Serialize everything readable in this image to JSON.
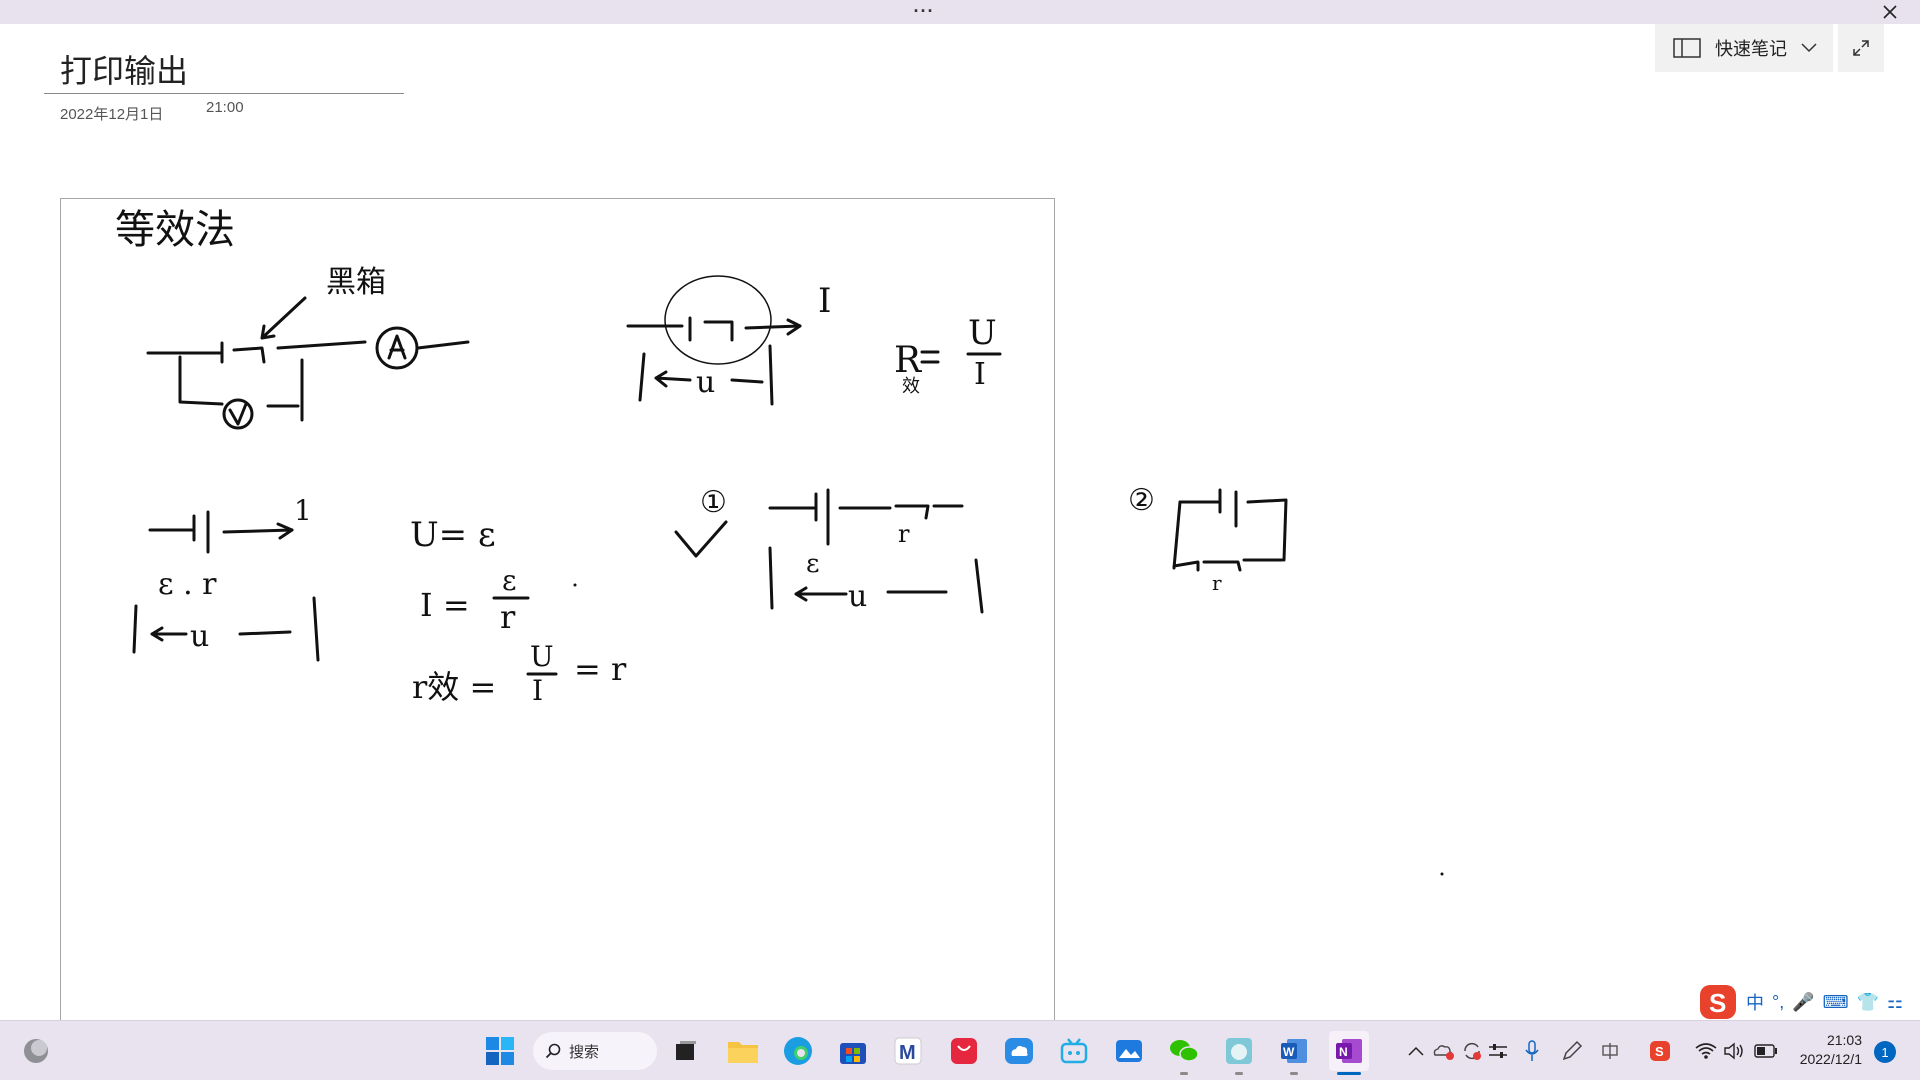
{
  "window": {
    "more_label": "···",
    "close_label": "✕"
  },
  "toolbar": {
    "quick_note_label": "快速笔记"
  },
  "page": {
    "title": "打印输出",
    "date": "2022年12月1日",
    "time": "21:00"
  },
  "ink": {
    "heading": "等效法",
    "black_box": "黑箱",
    "current_I": "I",
    "R_formula_lhs": "R",
    "R_formula_sub": "效",
    "R_formula_num": "U",
    "R_formula_den": "I",
    "label_e_r": "ε . r",
    "label_u_bottom": "u",
    "eq1": "U= ε",
    "eq2_lhs": "I =",
    "eq2_num": "ε",
    "eq2_den": "r",
    "eq3_lhs": "r效 =",
    "eq3_num": "U",
    "eq3_den": "I",
    "eq3_rhs": "= r",
    "mark_1": "①",
    "mark_2": "②",
    "label_epsilon": "ε",
    "label_r": "r",
    "label_1": "1"
  },
  "ime": {
    "items": [
      "中",
      "°,",
      "🎤",
      "⌨",
      "👕",
      "⚏"
    ]
  },
  "taskbar": {
    "search_label": "搜索",
    "clock_time": "21:03",
    "clock_date": "2022/12/1",
    "notification_count": "1"
  },
  "colors": {
    "taskbar_bg": "#e9e2ef",
    "accent": "#0067c0",
    "onenote": "#7719aa",
    "sogou": "#e8412c"
  }
}
